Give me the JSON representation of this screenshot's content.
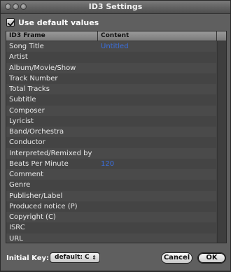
{
  "window": {
    "title": "ID3 Settings"
  },
  "options": {
    "use_default_label": "Use default values",
    "use_default_checked": true
  },
  "table": {
    "headers": {
      "frame": "ID3 Frame",
      "content": "Content"
    },
    "rows": [
      {
        "frame": "Song Title",
        "content": "Untitled"
      },
      {
        "frame": "Artist",
        "content": ""
      },
      {
        "frame": "Album/Movie/Show",
        "content": ""
      },
      {
        "frame": "Track Number",
        "content": ""
      },
      {
        "frame": "Total Tracks",
        "content": ""
      },
      {
        "frame": "Subtitle",
        "content": ""
      },
      {
        "frame": "Composer",
        "content": ""
      },
      {
        "frame": "Lyricist",
        "content": ""
      },
      {
        "frame": "Band/Orchestra",
        "content": ""
      },
      {
        "frame": "Conductor",
        "content": ""
      },
      {
        "frame": "Interpreted/Remixed by",
        "content": ""
      },
      {
        "frame": "Beats Per Minute",
        "content": "120"
      },
      {
        "frame": "Comment",
        "content": ""
      },
      {
        "frame": "Genre",
        "content": ""
      },
      {
        "frame": "Publisher/Label",
        "content": ""
      },
      {
        "frame": "Produced notice (P)",
        "content": ""
      },
      {
        "frame": "Copyright (C)",
        "content": ""
      },
      {
        "frame": "ISRC",
        "content": ""
      },
      {
        "frame": "URL",
        "content": ""
      }
    ]
  },
  "footer": {
    "initial_key_label": "Initial Key:",
    "initial_key_value": "default: C",
    "cancel_label": "Cancel",
    "ok_label": "OK"
  }
}
